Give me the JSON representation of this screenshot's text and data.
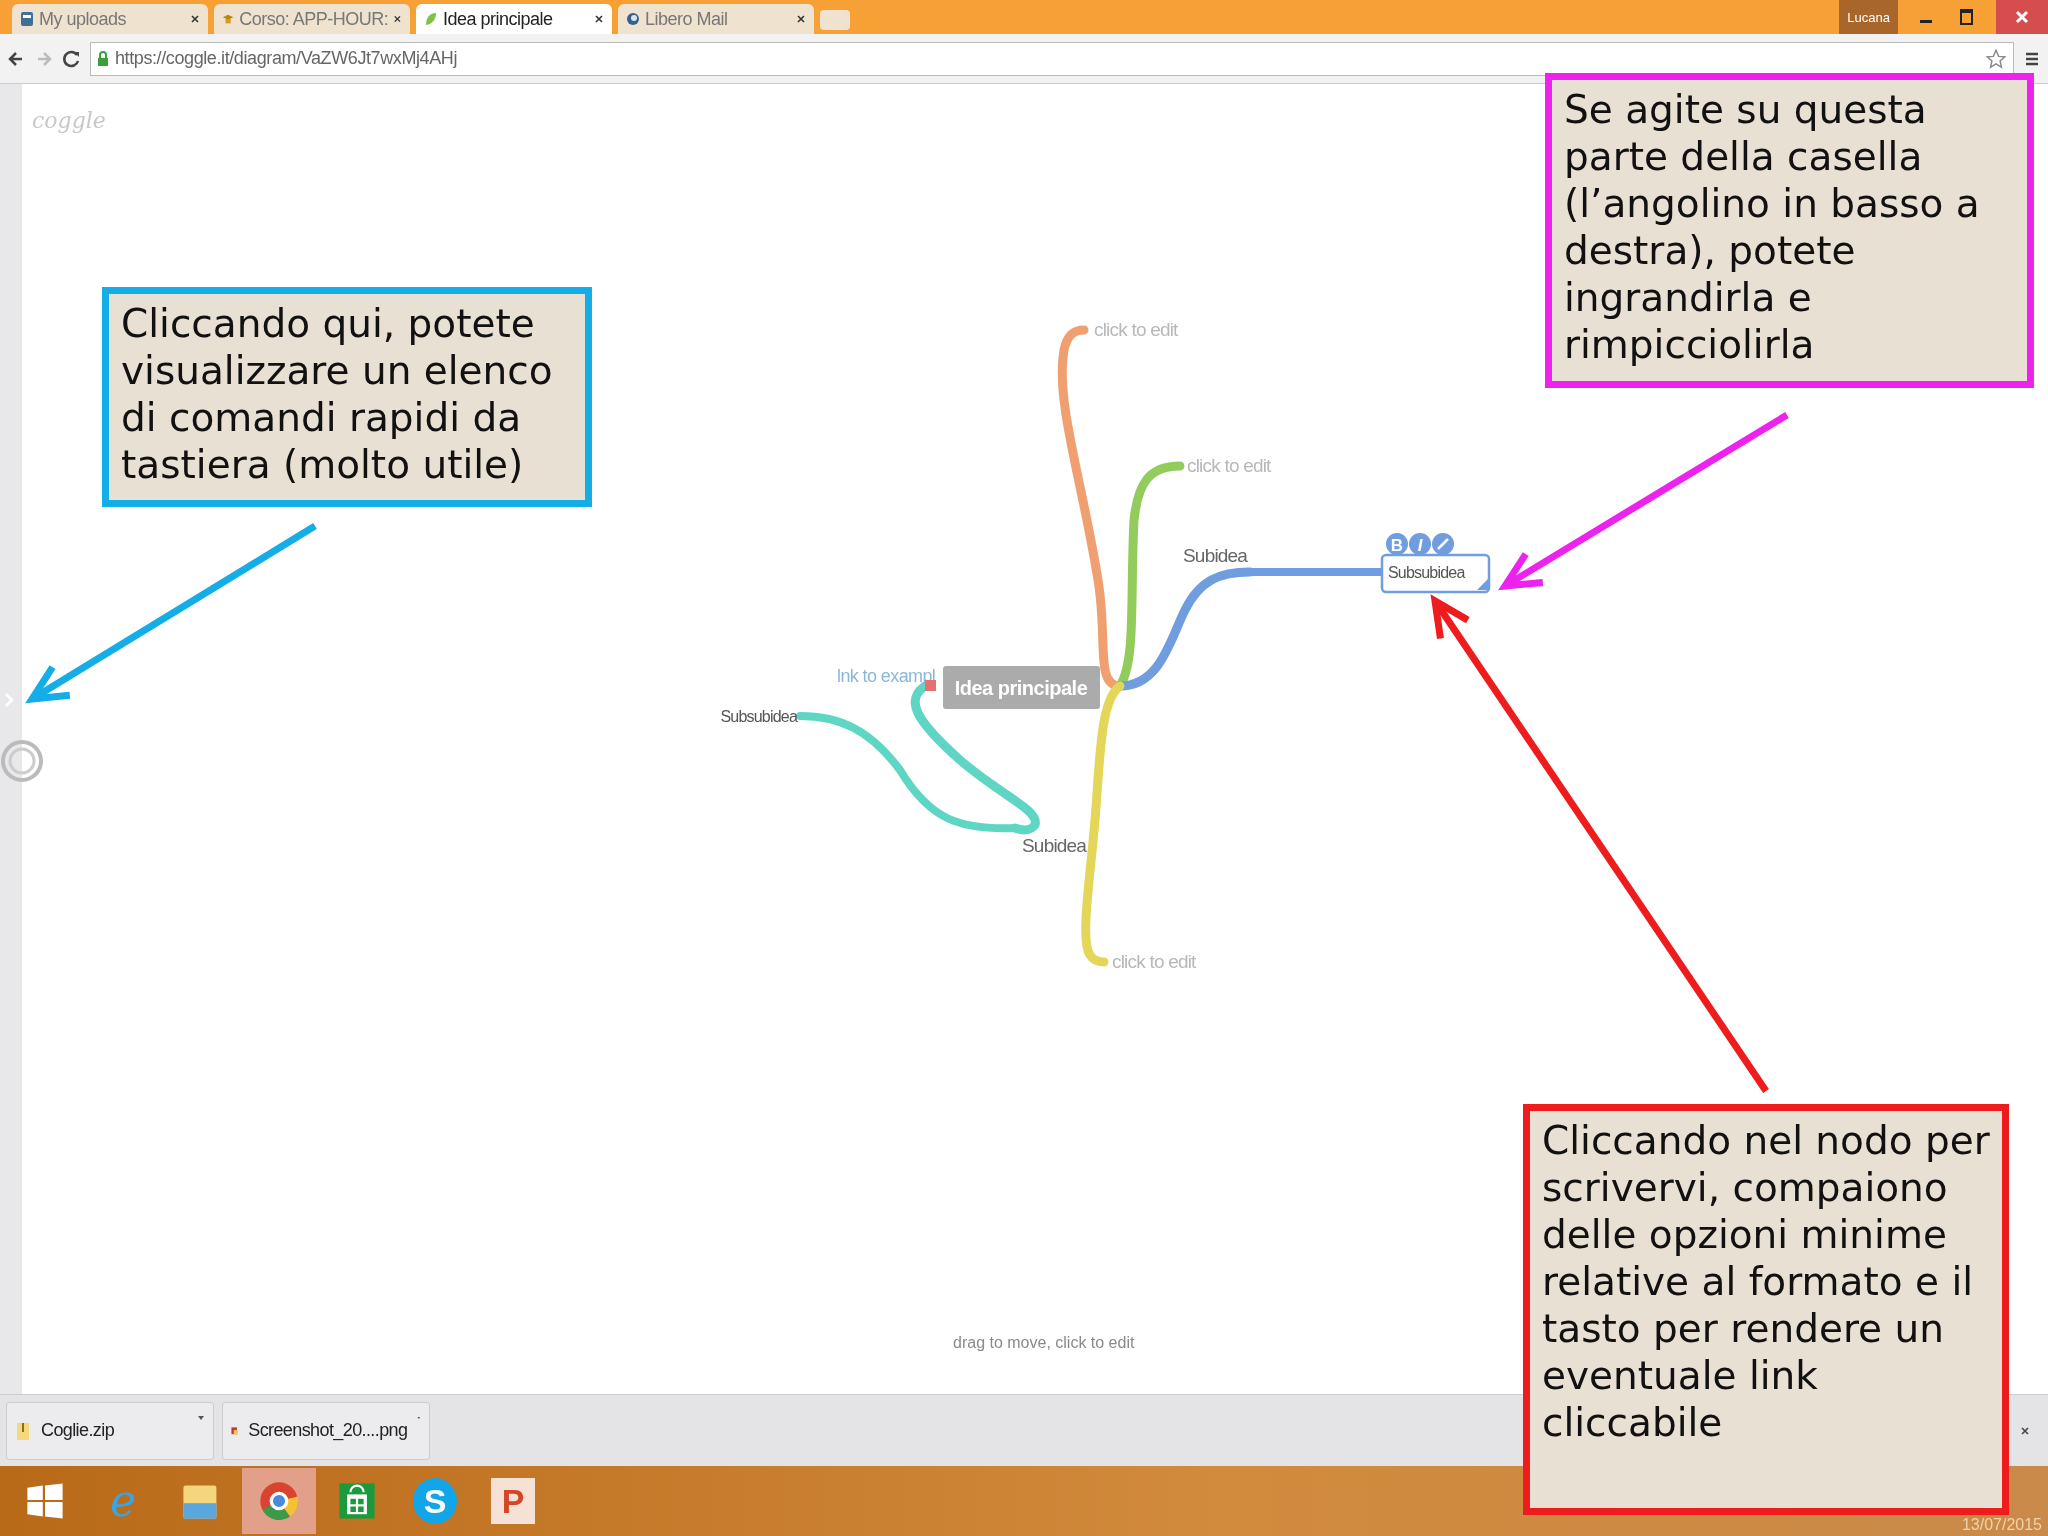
{
  "browser": {
    "tabs": [
      {
        "title": "My uploads",
        "kind": "doc",
        "selected": false
      },
      {
        "title": "Corso: APP-HOUR:",
        "kind": "course",
        "selected": false
      },
      {
        "title": "Idea principale",
        "kind": "coggle",
        "selected": true
      },
      {
        "title": "Libero Mail",
        "kind": "mail",
        "selected": false
      }
    ],
    "user": "Lucana",
    "url": "https://coggle.it/diagram/VaZW6Jt7wxMj4AHj"
  },
  "page": {
    "logo": "coggle",
    "hint": "drag to move, click to edit",
    "mind_map": {
      "root": {
        "label": "Idea principale",
        "link_text": "lnk to exampl"
      },
      "branches": [
        {
          "color": "#f0a070",
          "label": "click to edit"
        },
        {
          "color": "#92cc5c",
          "label": "click to edit"
        },
        {
          "color": "#6f9de0",
          "label": "Subidea",
          "children": [
            {
              "label": "Subsubidea",
              "editing": true,
              "toolbar": [
                {
                  "kind": "bold",
                  "glyph": "B"
                },
                {
                  "kind": "italic",
                  "glyph": "I"
                },
                {
                  "kind": "link"
                }
              ]
            }
          ]
        },
        {
          "color": "#e4d658",
          "label": "click to edit"
        },
        {
          "color": "#5fd6c4",
          "label": "Subidea",
          "children": [
            {
              "label": "Subsubidea",
              "editing": false
            }
          ]
        }
      ]
    }
  },
  "downloads": [
    {
      "name": "Coglie.zip",
      "kind": "zip"
    },
    {
      "name": "Screenshot_20....png",
      "kind": "image"
    }
  ],
  "taskbar": {
    "apps": [
      {
        "kind": "start",
        "selected": false
      },
      {
        "kind": "ie",
        "glyph": "e",
        "selected": false
      },
      {
        "kind": "folder",
        "selected": false
      },
      {
        "kind": "chrome",
        "selected": true
      },
      {
        "kind": "store",
        "selected": false
      },
      {
        "kind": "skype",
        "glyph": "S",
        "selected": false
      },
      {
        "kind": "powerpoint",
        "glyph": "P",
        "selected": false
      }
    ],
    "date": "13/07/2015"
  },
  "annotations": [
    {
      "color": "#13aee8",
      "text": "Cliccando qui, potete visualizzare un elenco di comandi rapidi da tastiera (molto utile)"
    },
    {
      "color": "#ee22ee",
      "text": "Se agite su questa parte della casella (l’angolino in basso a destra), potete ingrandirla e rimpicciolirla"
    },
    {
      "color": "#ee1c1c",
      "text": "Cliccando nel nodo per scrivervi, compaiono delle opzioni minime relative al formato e il tasto per rendere un eventuale link cliccabile"
    }
  ]
}
